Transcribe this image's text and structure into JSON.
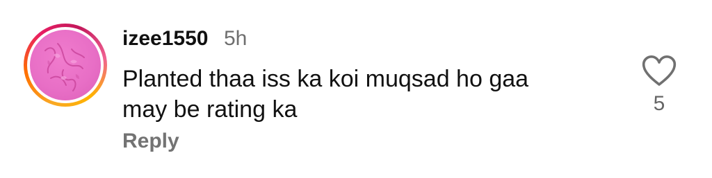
{
  "comment": {
    "username": "izee1550",
    "time": "5h",
    "text_line1": "Planted thaa iss ka koi muqsad ho gaa",
    "text_line2": "may be rating ka",
    "reply_label": "Reply",
    "like_count": "5",
    "like_icon": "heart-outline-icon"
  },
  "colors": {
    "avatar_bg": "#e86fc6",
    "secondary_text": "#737373"
  }
}
